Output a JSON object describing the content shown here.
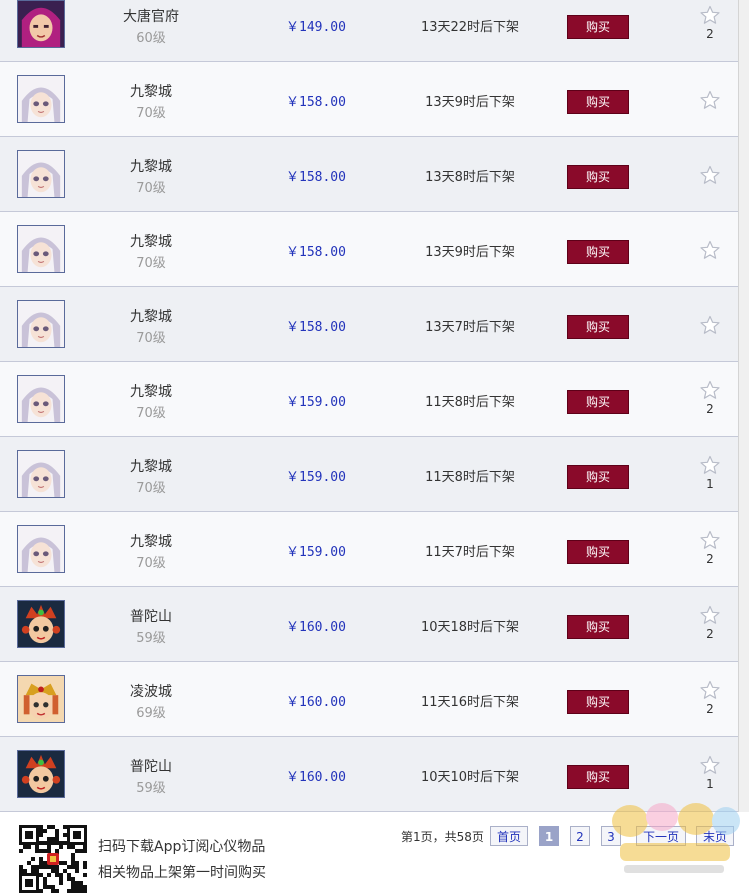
{
  "listings": [
    {
      "server": "大唐官府",
      "level": "60级",
      "price": "￥149.00",
      "time": "13天22时后下架",
      "buy": "购买",
      "favorites": "2",
      "avatar": "magenta-hair-character"
    },
    {
      "server": "九黎城",
      "level": "70级",
      "price": "￥158.00",
      "time": "13天9时后下架",
      "buy": "购买",
      "favorites": "",
      "avatar": "silver-hair-character"
    },
    {
      "server": "九黎城",
      "level": "70级",
      "price": "￥158.00",
      "time": "13天8时后下架",
      "buy": "购买",
      "favorites": "",
      "avatar": "silver-hair-character"
    },
    {
      "server": "九黎城",
      "level": "70级",
      "price": "￥158.00",
      "time": "13天9时后下架",
      "buy": "购买",
      "favorites": "",
      "avatar": "silver-hair-character"
    },
    {
      "server": "九黎城",
      "level": "70级",
      "price": "￥158.00",
      "time": "13天7时后下架",
      "buy": "购买",
      "favorites": "",
      "avatar": "silver-hair-character"
    },
    {
      "server": "九黎城",
      "level": "70级",
      "price": "￥159.00",
      "time": "11天8时后下架",
      "buy": "购买",
      "favorites": "2",
      "avatar": "silver-hair-character"
    },
    {
      "server": "九黎城",
      "level": "70级",
      "price": "￥159.00",
      "time": "11天8时后下架",
      "buy": "购买",
      "favorites": "1",
      "avatar": "silver-hair-character"
    },
    {
      "server": "九黎城",
      "level": "70级",
      "price": "￥159.00",
      "time": "11天7时后下架",
      "buy": "购买",
      "favorites": "2",
      "avatar": "silver-hair-character"
    },
    {
      "server": "普陀山",
      "level": "59级",
      "price": "￥160.00",
      "time": "10天18时后下架",
      "buy": "购买",
      "favorites": "2",
      "avatar": "red-crown-character"
    },
    {
      "server": "凌波城",
      "level": "69级",
      "price": "￥160.00",
      "time": "11天16时后下架",
      "buy": "购买",
      "favorites": "2",
      "avatar": "gold-crown-character"
    },
    {
      "server": "普陀山",
      "level": "59级",
      "price": "￥160.00",
      "time": "10天10时后下架",
      "buy": "购买",
      "favorites": "1",
      "avatar": "red-crown-character"
    }
  ],
  "footer": {
    "promo_line1": "扫码下载App订阅心仪物品",
    "promo_line2": "相关物品上架第一时间购买",
    "page_info": "第1页，共58页",
    "first_page": "首页",
    "pages": [
      "1",
      "2",
      "3"
    ],
    "next_page": "下一页",
    "last_page": "末页"
  },
  "colors": {
    "buy_button": "#8a0a2a",
    "price_text": "#2233bb",
    "row_alt": "#eef0f4",
    "current_page": "#9aa3c8"
  },
  "icons": {
    "favorite": "star-outline-icon",
    "qr": "qr-code-icon",
    "watermark": "xyq-official-forum-watermark"
  }
}
